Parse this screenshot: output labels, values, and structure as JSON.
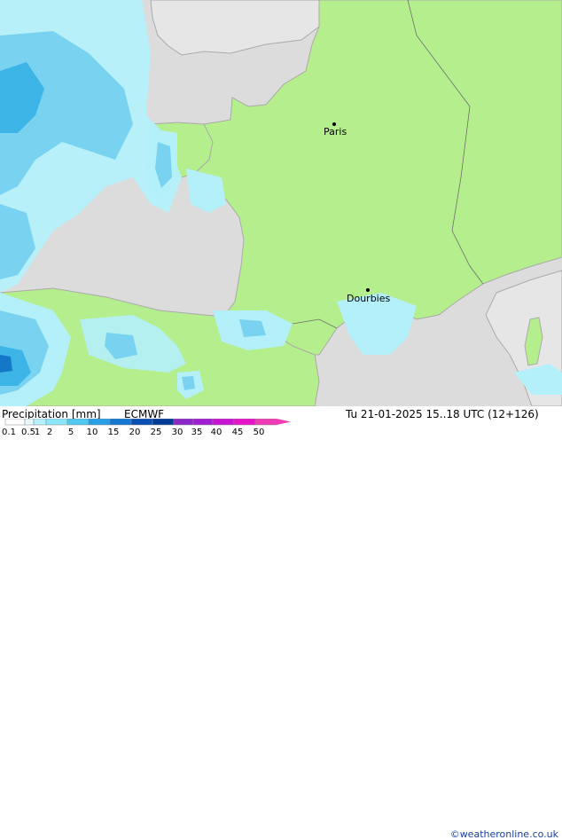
{
  "map": {
    "cities": [
      {
        "name": "Paris"
      },
      {
        "name": "Dourbies"
      }
    ],
    "colors": {
      "sea": "#dcdcdc",
      "land_no_data": "#e6e6e6",
      "land_model": "#b5ee8c",
      "coast": "#aaaaaa",
      "border": "#6e6e6e",
      "precip_light": "#b4f0fa",
      "precip_medium": "#78d2f0",
      "precip_heavy": "#3cb4e6",
      "precip_dark": "#1478c8"
    }
  },
  "footer": {
    "title": "Precipitation [mm]",
    "model": "ECMWF",
    "datetime": "Tu 21-01-2025 15..18 UTC (12+126)",
    "credit": "©weatheronline.co.uk"
  },
  "legend": {
    "ticks": [
      "0.1",
      "0.5",
      "1",
      "2",
      "5",
      "10",
      "15",
      "20",
      "25",
      "30",
      "35",
      "40",
      "45",
      "50"
    ],
    "colors": [
      "#ffffff",
      "#e6fafc",
      "#b4f0fa",
      "#8ce6f8",
      "#50c8f0",
      "#28a0e6",
      "#1478d2",
      "#0a50b4",
      "#003c96",
      "#8c28c8",
      "#a01ed2",
      "#c814d2",
      "#e614c8",
      "#f03cb4"
    ]
  }
}
